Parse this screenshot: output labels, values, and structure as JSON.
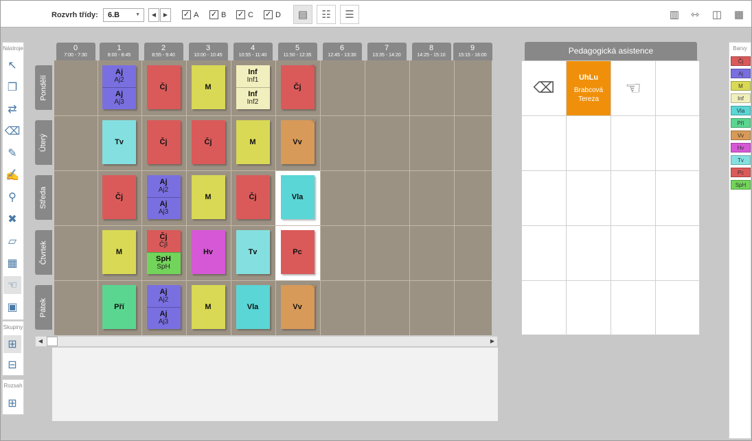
{
  "toolbar": {
    "class_label": "Rozvrh třídy:",
    "class_value": "6.B",
    "week_options": [
      {
        "label": "A",
        "checked": true
      },
      {
        "label": "B",
        "checked": true
      },
      {
        "label": "C",
        "checked": true
      },
      {
        "label": "D",
        "checked": true
      }
    ]
  },
  "tools_panel": {
    "title": "Nástroje",
    "groups_title": "Skupiny",
    "range_title": "Rozsah"
  },
  "periods": [
    {
      "num": "0",
      "time": "7:00 - 7:30"
    },
    {
      "num": "1",
      "time": "8:00 - 8:45"
    },
    {
      "num": "2",
      "time": "8:55 - 9:40"
    },
    {
      "num": "3",
      "time": "10:00 - 10:45"
    },
    {
      "num": "4",
      "time": "10:55 - 11:40"
    },
    {
      "num": "5",
      "time": "11:50 - 12:35"
    },
    {
      "num": "6",
      "time": "12:45 - 13:30"
    },
    {
      "num": "7",
      "time": "13:35 - 14:20"
    },
    {
      "num": "8",
      "time": "14:25 - 15:10"
    },
    {
      "num": "9",
      "time": "15:15 - 16:00"
    }
  ],
  "days": [
    "Pondělí",
    "Úterý",
    "Středa",
    "Čtvrtek",
    "Pátek"
  ],
  "lessons": [
    [
      null,
      [
        {
          "s": "Aj",
          "g": "Aj2",
          "c": "#7a6fe0"
        },
        {
          "s": "Aj",
          "g": "Aj3",
          "c": "#7a6fe0"
        }
      ],
      [
        {
          "s": "Čj",
          "c": "#da5a5a"
        }
      ],
      [
        {
          "s": "M",
          "c": "#d9d955"
        }
      ],
      [
        {
          "s": "Inf",
          "g": "Inf1",
          "c": "#f1efbd"
        },
        {
          "s": "Inf",
          "g": "Inf2",
          "c": "#f1efbd"
        }
      ],
      [
        {
          "s": "Čj",
          "c": "#da5a5a",
          "hand": true
        }
      ],
      null,
      null,
      null,
      null
    ],
    [
      null,
      [
        {
          "s": "Tv",
          "c": "#84e0e0"
        }
      ],
      [
        {
          "s": "Čj",
          "c": "#da5a5a"
        }
      ],
      [
        {
          "s": "Čj",
          "c": "#da5a5a"
        }
      ],
      [
        {
          "s": "M",
          "c": "#d9d955"
        }
      ],
      [
        {
          "s": "Vv",
          "c": "#d89a58",
          "hand": true
        }
      ],
      null,
      null,
      null,
      null
    ],
    [
      null,
      [
        {
          "s": "Čj",
          "c": "#da5a5a"
        }
      ],
      [
        {
          "s": "Aj",
          "g": "Aj2",
          "c": "#7a6fe0"
        },
        {
          "s": "Aj",
          "g": "Aj3",
          "c": "#7a6fe0"
        }
      ],
      [
        {
          "s": "M",
          "c": "#d9d955"
        }
      ],
      [
        {
          "s": "Čj",
          "c": "#da5a5a"
        }
      ],
      [
        {
          "s": "Vla",
          "c": "#5ad6d6",
          "white": true
        }
      ],
      null,
      null,
      null,
      null
    ],
    [
      null,
      [
        {
          "s": "M",
          "c": "#d9d955"
        }
      ],
      [
        {
          "s": "Čj",
          "g": "ČjI",
          "c": "#da5a5a"
        },
        {
          "s": "SpH",
          "g": "SpH",
          "c": "#72d45a"
        }
      ],
      [
        {
          "s": "Hv",
          "c": "#d658d6"
        }
      ],
      [
        {
          "s": "Tv",
          "c": "#84e0e0"
        }
      ],
      [
        {
          "s": "Pc",
          "c": "#da5a5a",
          "white": true
        }
      ],
      null,
      null,
      null,
      null
    ],
    [
      null,
      [
        {
          "s": "Pří",
          "c": "#5ad690"
        }
      ],
      [
        {
          "s": "Aj",
          "g": "Aj2",
          "c": "#7a6fe0"
        },
        {
          "s": "Aj",
          "g": "Aj3",
          "c": "#7a6fe0"
        }
      ],
      [
        {
          "s": "M",
          "c": "#d9d955"
        }
      ],
      [
        {
          "s": "Vla",
          "c": "#5ad6d6"
        }
      ],
      [
        {
          "s": "Vv",
          "c": "#d89a58",
          "hand": true
        }
      ],
      null,
      null,
      null,
      null
    ]
  ],
  "assistance": {
    "title": "Pedagogická asistence",
    "card": {
      "abbr": "UhLu",
      "name": "Brabcová Tereza",
      "color": "#f0900a"
    }
  },
  "colors_panel": {
    "title": "Barvy",
    "items": [
      {
        "label": "Čj",
        "color": "#da5a5a"
      },
      {
        "label": "Aj",
        "color": "#7a6fe0"
      },
      {
        "label": "M",
        "color": "#d9d955"
      },
      {
        "label": "Inf",
        "color": "#f1efbd"
      },
      {
        "label": "Vla",
        "color": "#5ad6d6"
      },
      {
        "label": "Pří",
        "color": "#5ad690"
      },
      {
        "label": "Vv",
        "color": "#d89a58"
      },
      {
        "label": "Hv",
        "color": "#d658d6"
      },
      {
        "label": "Tv",
        "color": "#84e0e0"
      },
      {
        "label": "Pc",
        "color": "#da5a5a"
      },
      {
        "label": "SpH",
        "color": "#72d45a"
      }
    ]
  }
}
